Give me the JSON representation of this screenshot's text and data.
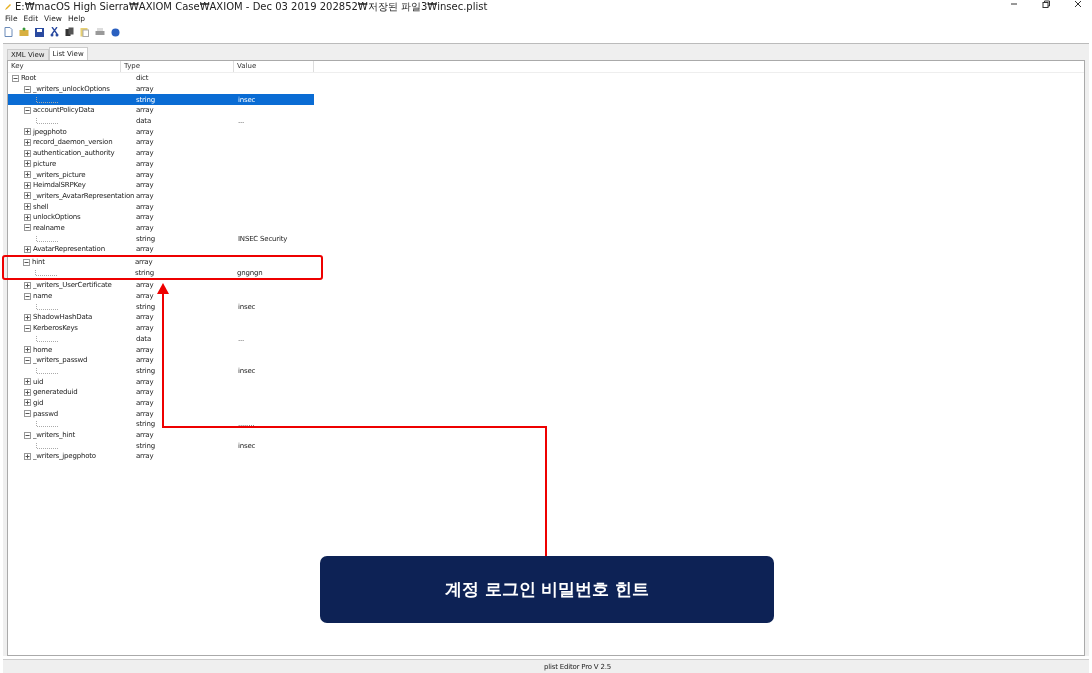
{
  "window": {
    "title": "E:₩macOS High Sierra₩AXIOM Case₩AXIOM - Dec 03 2019 202852₩저장된 파일3₩insec.plist"
  },
  "menu": [
    "File",
    "Edit",
    "View",
    "Help"
  ],
  "tabs": [
    {
      "label": "XML View",
      "selected": false
    },
    {
      "label": "List View",
      "selected": true
    }
  ],
  "columns": [
    "Key",
    "Type",
    "Value"
  ],
  "tree": [
    {
      "key": "Root",
      "type": "dict",
      "expanded": true,
      "selected": false,
      "children": [
        {
          "key": "_writers_unlockOptions",
          "type": "array",
          "expanded": true,
          "selected": false,
          "highlighted": false,
          "children": [
            {
              "type": "string",
              "value": "insec",
              "selected": true
            }
          ]
        },
        {
          "key": "accountPolicyData",
          "type": "array",
          "expanded": true,
          "selected": false,
          "highlighted": false,
          "children": [
            {
              "type": "data",
              "value": "...",
              "selected": false
            }
          ]
        },
        {
          "key": "jpegphoto",
          "type": "array",
          "expanded": false,
          "selected": false,
          "highlighted": false
        },
        {
          "key": "record_daemon_version",
          "type": "array",
          "expanded": false,
          "selected": false,
          "highlighted": false
        },
        {
          "key": "authentication_authority",
          "type": "array",
          "expanded": false,
          "selected": false,
          "highlighted": false
        },
        {
          "key": "picture",
          "type": "array",
          "expanded": false,
          "selected": false,
          "highlighted": false
        },
        {
          "key": "_writers_picture",
          "type": "array",
          "expanded": false,
          "selected": false,
          "highlighted": false
        },
        {
          "key": "HeimdalSRPKey",
          "type": "array",
          "expanded": false,
          "selected": false,
          "highlighted": false
        },
        {
          "key": "_writers_AvatarRepresentation",
          "type": "array",
          "expanded": false,
          "selected": false,
          "highlighted": false
        },
        {
          "key": "shell",
          "type": "array",
          "expanded": false,
          "selected": false,
          "highlighted": false
        },
        {
          "key": "unlockOptions",
          "type": "array",
          "expanded": false,
          "selected": false,
          "highlighted": false
        },
        {
          "key": "realname",
          "type": "array",
          "expanded": true,
          "selected": false,
          "highlighted": false,
          "children": [
            {
              "type": "string",
              "value": "INSEC Security",
              "selected": false
            }
          ]
        },
        {
          "key": "AvatarRepresentation",
          "type": "array",
          "expanded": false,
          "selected": false,
          "highlighted": false
        },
        {
          "key": "hint",
          "type": "array",
          "expanded": true,
          "selected": false,
          "highlighted": true,
          "children": [
            {
              "type": "string",
              "value": "gngngn",
              "selected": false
            }
          ]
        },
        {
          "key": "_writers_UserCertificate",
          "type": "array",
          "expanded": false,
          "selected": false,
          "highlighted": false
        },
        {
          "key": "name",
          "type": "array",
          "expanded": true,
          "selected": false,
          "highlighted": false,
          "children": [
            {
              "type": "string",
              "value": "insec",
              "selected": false
            }
          ]
        },
        {
          "key": "ShadowHashData",
          "type": "array",
          "expanded": false,
          "selected": false,
          "highlighted": false
        },
        {
          "key": "KerberosKeys",
          "type": "array",
          "expanded": true,
          "selected": false,
          "highlighted": false,
          "children": [
            {
              "type": "data",
              "value": "...",
              "selected": false
            }
          ]
        },
        {
          "key": "home",
          "type": "array",
          "expanded": false,
          "selected": false,
          "highlighted": false
        },
        {
          "key": "_writers_passwd",
          "type": "array",
          "expanded": true,
          "selected": false,
          "highlighted": false,
          "children": [
            {
              "type": "string",
              "value": "insec",
              "selected": false
            }
          ]
        },
        {
          "key": "uid",
          "type": "array",
          "expanded": false,
          "selected": false,
          "highlighted": false
        },
        {
          "key": "generateduid",
          "type": "array",
          "expanded": false,
          "selected": false,
          "highlighted": false
        },
        {
          "key": "gid",
          "type": "array",
          "expanded": false,
          "selected": false,
          "highlighted": false
        },
        {
          "key": "passwd",
          "type": "array",
          "expanded": true,
          "selected": false,
          "highlighted": false,
          "children": [
            {
              "type": "string",
              "value": "........",
              "selected": false
            }
          ]
        },
        {
          "key": "_writers_hint",
          "type": "array",
          "expanded": true,
          "selected": false,
          "highlighted": false,
          "children": [
            {
              "type": "string",
              "value": "insec",
              "selected": false
            }
          ]
        },
        {
          "key": "_writers_jpegphoto",
          "type": "array",
          "expanded": false,
          "selected": false,
          "highlighted": false
        }
      ]
    }
  ],
  "callout": {
    "text": "계정 로그인 비밀번호 힌트"
  },
  "status_bar": "plist Editor Pro V 2.5"
}
